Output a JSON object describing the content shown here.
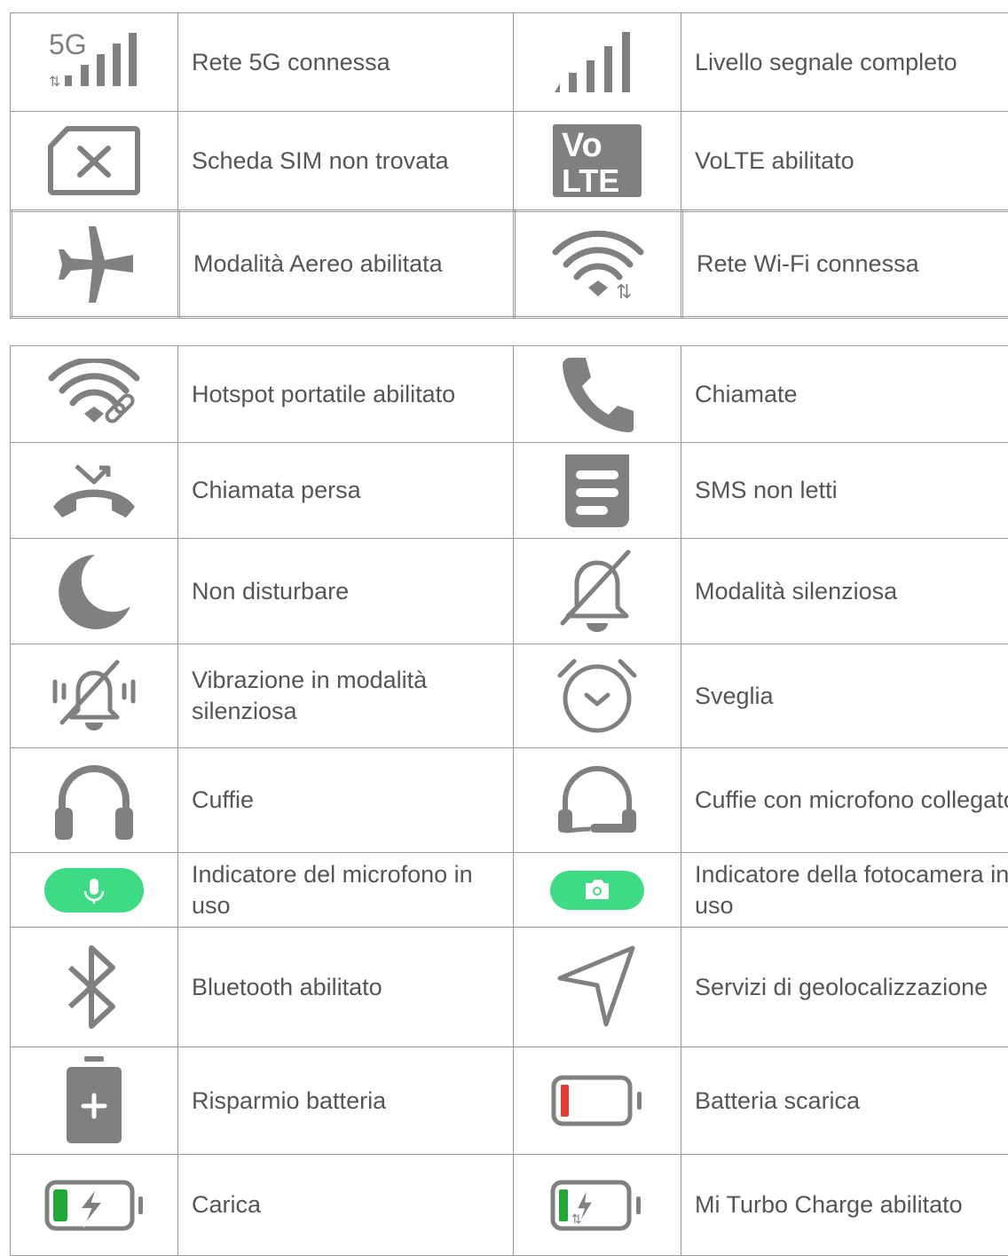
{
  "colors": {
    "icon": "#808080",
    "text": "#555555",
    "green": "#3ddc84",
    "red": "#e53935",
    "battery_green": "#21a836"
  },
  "table1": [
    {
      "left_icon": "5g-signal-icon",
      "left_label": "Rete 5G connessa",
      "right_icon": "signal-strength-icon",
      "right_label": "Livello segnale completo"
    },
    {
      "left_icon": "sim-not-found-icon",
      "left_label": "Scheda SIM non trovata",
      "right_icon": "volte-icon",
      "right_label": "VoLTE abilitato"
    },
    {
      "left_icon": "airplane-icon",
      "left_label": "Modalità Aereo abilitata",
      "right_icon": "wifi-icon",
      "right_label": "Rete Wi-Fi connessa"
    }
  ],
  "icon_text": {
    "fiveg": "5G",
    "vo": "Vo",
    "lte": "LTE"
  },
  "table2": [
    {
      "left_icon": "hotspot-icon",
      "left_label": "Hotspot portatile abilitato",
      "right_icon": "phone-icon",
      "right_label": "Chiamate"
    },
    {
      "left_icon": "missed-call-icon",
      "left_label": "Chiamata persa",
      "right_icon": "sms-icon",
      "right_label": "SMS non letti"
    },
    {
      "left_icon": "moon-icon",
      "left_label": "Non disturbare",
      "right_icon": "bell-off-icon",
      "right_label": "Modalità silenziosa"
    },
    {
      "left_icon": "vibrate-silent-icon",
      "left_label": "Vibrazione in modalità silenziosa",
      "right_icon": "alarm-icon",
      "right_label": "Sveglia"
    },
    {
      "left_icon": "headphones-icon",
      "left_label": "Cuffie",
      "right_icon": "headset-mic-icon",
      "right_label": "Cuffie con microfono collegato"
    },
    {
      "left_icon": "mic-indicator-icon",
      "left_label": "Indicatore del microfono in uso",
      "right_icon": "camera-indicator-icon",
      "right_label": "Indicatore della fotocamera in uso"
    },
    {
      "left_icon": "bluetooth-icon",
      "left_label": "Bluetooth abilitato",
      "right_icon": "location-icon",
      "right_label": "Servizi di geolocalizzazione"
    },
    {
      "left_icon": "battery-saver-icon",
      "left_label": "Risparmio batteria",
      "right_icon": "battery-low-icon",
      "right_label": "Batteria scarica"
    },
    {
      "left_icon": "charging-icon",
      "left_label": "Carica",
      "right_icon": "turbo-charge-icon",
      "right_label": "Mi Turbo Charge abilitato"
    }
  ]
}
